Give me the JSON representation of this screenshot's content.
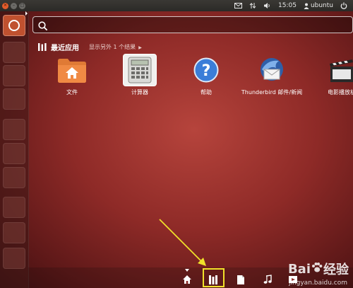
{
  "panel": {
    "time": "15:05",
    "user": "ubuntu"
  },
  "search": {
    "placeholder": "",
    "value": ""
  },
  "recent_apps": {
    "title": "最近应用",
    "more_label": "显示另外 1 个结果"
  },
  "apps": [
    {
      "label": "文件",
      "icon": "folder-home-icon"
    },
    {
      "label": "计算器",
      "icon": "calculator-icon"
    },
    {
      "label": "帮助",
      "icon": "help-icon"
    },
    {
      "label": "Thunderbird 邮件/新闻",
      "icon": "thunderbird-icon"
    },
    {
      "label": "电影播放机",
      "icon": "movie-player-icon"
    }
  ],
  "lenses": [
    "home-lens-icon",
    "applications-lens-icon",
    "files-lens-icon",
    "music-lens-icon",
    "video-lens-icon"
  ],
  "watermark": {
    "brand": "Bai",
    "brand_suffix": "经验",
    "url": "jingyan.baidu.com"
  },
  "colors": {
    "accent_orange": "#e25c2b",
    "highlight_yellow": "#f1e12a"
  }
}
